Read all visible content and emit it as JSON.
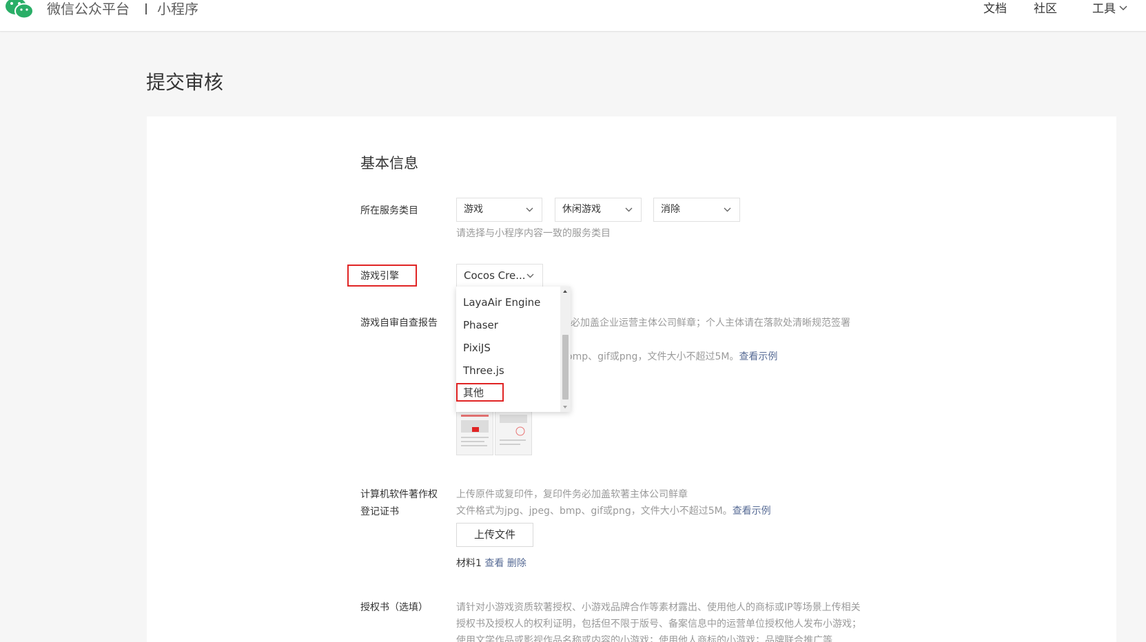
{
  "header": {
    "logo_icon": "wechat-logo-icon",
    "platform_title": "微信公众平台",
    "section_title": "小程序",
    "nav": {
      "docs": "文档",
      "community": "社区",
      "tools": "工具"
    }
  },
  "page": {
    "title": "提交审核"
  },
  "form": {
    "section_title": "基本信息",
    "service_category": {
      "label": "所在服务类目",
      "selects": [
        "游戏",
        "休闲游戏",
        "消除"
      ],
      "hint": "请选择与小程序内容一致的服务类目"
    },
    "game_engine": {
      "label": "游戏引擎",
      "selected": "Cocos Cre...",
      "options": [
        "LayaAir Engine",
        "Phaser",
        "PixiJS",
        "Three.js",
        "其他"
      ]
    },
    "self_check_report": {
      "label": "游戏自审自查报告",
      "hint_line1": "件务必加盖企业运营主体公司鲜章；个人主体请在落款处清晰规范签署",
      "hint_line2": "omp、gif或png，文件大小不超过5M。",
      "example_link": "查看示例"
    },
    "software_copyright": {
      "label_line1": "计算机软件著作权",
      "label_line2": "登记证书",
      "hint_line1": "上传原件或复印件，复印件务必加盖软著主体公司鲜章",
      "hint_line2": "文件格式为jpg、jpeg、bmp、gif或png，文件大小不超过5M。",
      "example_link": "查看示例",
      "upload_button": "上传文件",
      "material_name": "材料1",
      "view_link": "查看",
      "delete_link": "删除"
    },
    "authorization": {
      "label": "授权书（选填）",
      "hint_line1": "请针对小游戏资质软著授权、小游戏品牌合作等素材露出、使用他人的商标或IP等场景上传相关",
      "hint_line2": "授权书及授权人的权利证明，包括但不限于版号、备案信息中的运营单位授权他人发布小游戏；",
      "hint_line3": "使用文学作品或影视作品名称或内容的小游戏；使用他人商标的小游戏；品牌联合推广等"
    }
  },
  "colors": {
    "link": "#576b95",
    "highlight": "#e02424",
    "hint": "#9a9a9a",
    "wechat_green": "#2aae67"
  }
}
